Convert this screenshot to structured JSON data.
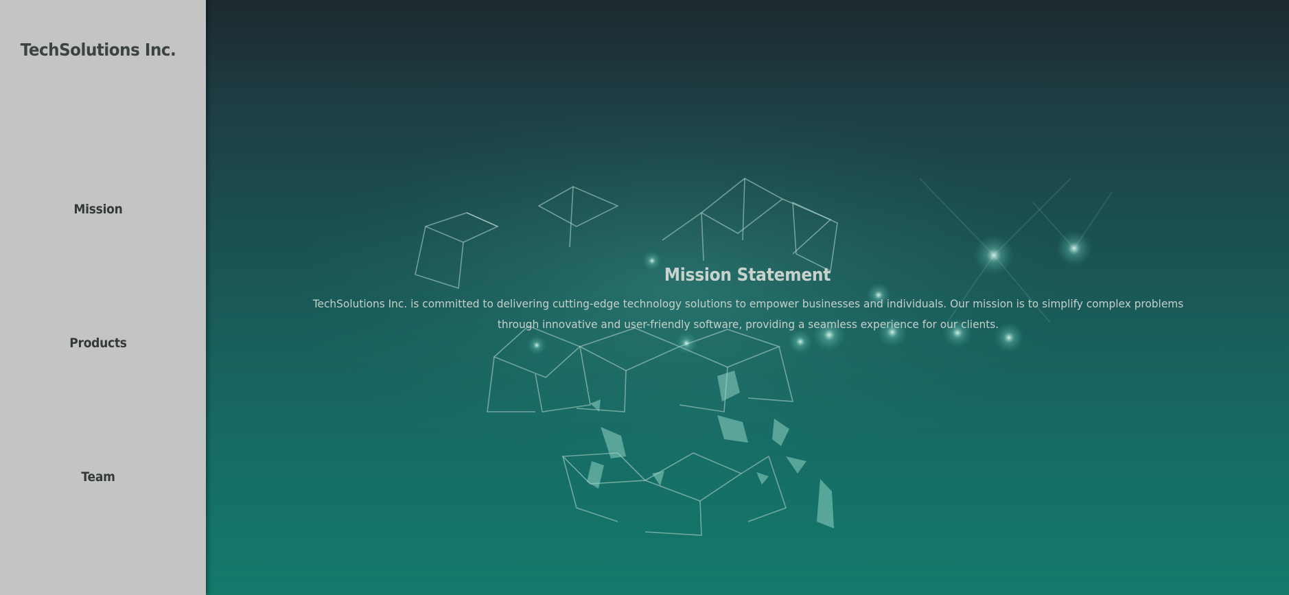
{
  "sidebar": {
    "brand": "TechSolutions Inc.",
    "nav": [
      {
        "label": "Mission"
      },
      {
        "label": "Products"
      },
      {
        "label": "Team"
      }
    ]
  },
  "hero": {
    "title": "Mission Statement",
    "text": "TechSolutions Inc. is committed to delivering cutting-edge technology solutions to empower businesses and individuals. Our mission is to simplify complex problems through innovative and user-friendly software, providing a seamless experience for our clients."
  },
  "colors": {
    "sidebar_bg": "#c4c4c4",
    "hero_top": "#1d2a2f",
    "hero_bottom": "#137a6c",
    "text_light": "#c9d2cc"
  }
}
